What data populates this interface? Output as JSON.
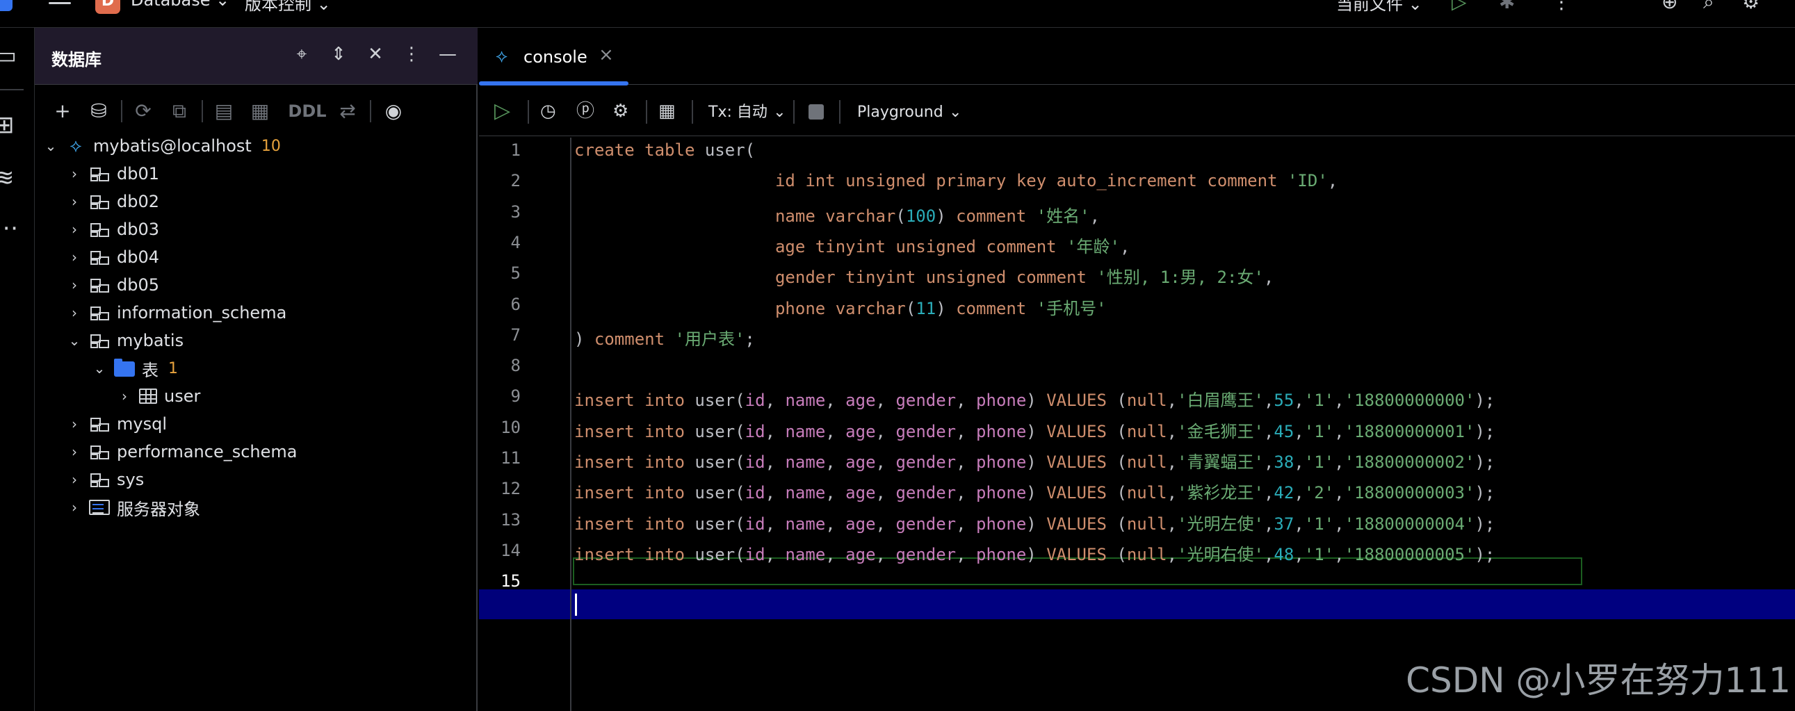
{
  "topbar": {
    "project_name": "Database",
    "vcs_label": "版本控制",
    "run_config": "当前文件",
    "project_badge": "D",
    "icons": [
      "app-logo-icon",
      "hamburger-menu-icon",
      "run-icon",
      "debug-icon",
      "more-icon",
      "add-collaborator-icon",
      "search-icon",
      "settings-icon"
    ]
  },
  "strip": {
    "icons": [
      "project-folder-icon",
      "structure-icon",
      "database-icon",
      "more-tools-icon"
    ]
  },
  "db_panel": {
    "title": "数据库",
    "header_icons": [
      "locate-icon",
      "expand-collapse-icon",
      "collapse-all-icon",
      "more-options-icon",
      "hide-panel-icon"
    ],
    "toolbar": {
      "ddl_label": "DDL",
      "icons": [
        "add-icon",
        "datasource-properties-icon",
        "refresh-icon",
        "jump-to-query-console-icon",
        "console-icon",
        "table-editor-icon",
        "ddl-icon",
        "compare-icon",
        "eye-view-icon"
      ]
    },
    "tree": [
      {
        "label": "mybatis@localhost",
        "count": "10",
        "type": "datasource",
        "expanded": true,
        "depth": 0
      },
      {
        "label": "db01",
        "type": "schema",
        "depth": 1
      },
      {
        "label": "db02",
        "type": "schema",
        "depth": 1
      },
      {
        "label": "db03",
        "type": "schema",
        "depth": 1
      },
      {
        "label": "db04",
        "type": "schema",
        "depth": 1
      },
      {
        "label": "db05",
        "type": "schema",
        "depth": 1
      },
      {
        "label": "information_schema",
        "type": "schema",
        "depth": 1
      },
      {
        "label": "mybatis",
        "type": "schema",
        "expanded": true,
        "depth": 1
      },
      {
        "label": "表",
        "count": "1",
        "type": "folder",
        "expanded": true,
        "depth": 2
      },
      {
        "label": "user",
        "type": "table",
        "depth": 3
      },
      {
        "label": "mysql",
        "type": "schema",
        "depth": 1
      },
      {
        "label": "performance_schema",
        "type": "schema",
        "depth": 1
      },
      {
        "label": "sys",
        "type": "schema",
        "depth": 1
      },
      {
        "label": "服务器对象",
        "type": "server-objects",
        "depth": 1
      }
    ]
  },
  "editor": {
    "tab_label": "console",
    "toolbar": {
      "tx_label": "Tx: 自动",
      "playground_label": "Playground",
      "icons": [
        "execute-icon",
        "history-icon",
        "explain-plan-icon",
        "settings-icon",
        "table-output-icon",
        "stop-icon"
      ]
    },
    "lines": [
      "create table user(",
      "                    id int unsigned primary key auto_increment comment 'ID',",
      "                    name varchar(100) comment '姓名',",
      "                    age tinyint unsigned comment '年龄',",
      "                    gender tinyint unsigned comment '性别, 1:男, 2:女',",
      "                    phone varchar(11) comment '手机号'",
      ") comment '用户表';",
      "",
      "insert into user(id, name, age, gender, phone) VALUES (null,'白眉鹰王',55,'1','18800000000');",
      "insert into user(id, name, age, gender, phone) VALUES (null,'金毛狮王',45,'1','18800000001');",
      "insert into user(id, name, age, gender, phone) VALUES (null,'青翼蝠王',38,'1','18800000002');",
      "insert into user(id, name, age, gender, phone) VALUES (null,'紫衫龙王',42,'2','18800000003');",
      "insert into user(id, name, age, gender, phone) VALUES (null,'光明左使',37,'1','18800000004');",
      "insert into user(id, name, age, gender, phone) VALUES (null,'光明右使',48,'1','18800000005');",
      ""
    ],
    "current_line": 15
  },
  "watermark": "CSDN @小罗在努力111",
  "colors": {
    "accent": "#3574f0",
    "keyword": "#cf8e6d",
    "string": "#6aab73",
    "number": "#2aacb8",
    "identifier": "#c77dbb",
    "current_line": "#000080",
    "count_badge": "#e8a33d"
  }
}
